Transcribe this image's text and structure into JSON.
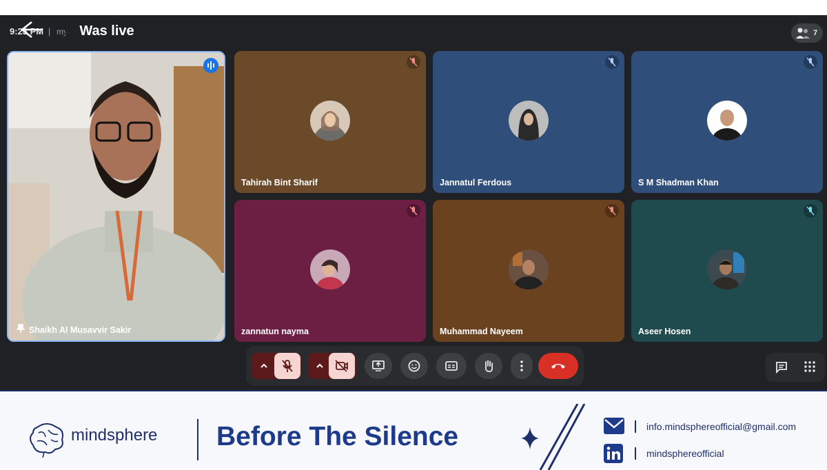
{
  "status": {
    "time": "9:23 PM",
    "meeting_code": "my-",
    "live_label": "Was live"
  },
  "participants_count": "7",
  "presenter": {
    "name": "Shaikh Al Musavvir Sakir"
  },
  "tiles": [
    {
      "name": "Tahirah Bint Sharif",
      "bg": "#6b4a2a"
    },
    {
      "name": "Jannatul Ferdous",
      "bg": "#2f4e7a"
    },
    {
      "name": "S M Shadman Khan",
      "bg": "#2f4e7a"
    },
    {
      "name": "zannatun nayma",
      "bg": "#6d1f43"
    },
    {
      "name": "Muhammad Nayeem",
      "bg": "#6b4220"
    },
    {
      "name": "Aseer Hosen",
      "bg": "#1f4a4e"
    }
  ],
  "banner": {
    "brand": "mindsphere",
    "headline": "Before The Silence",
    "email": "info.mindsphereofficial@gmail.com",
    "linkedin": "mindsphereofficial"
  }
}
